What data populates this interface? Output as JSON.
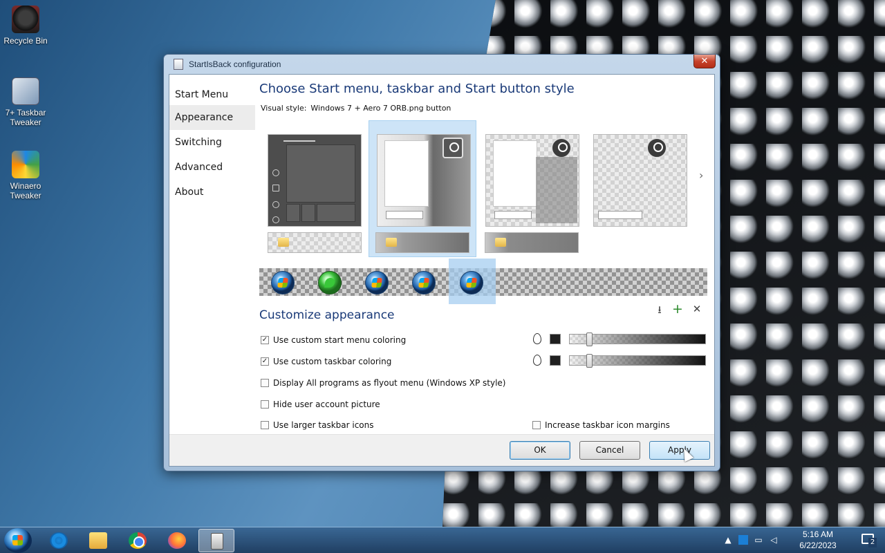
{
  "desktop": {
    "icons": [
      {
        "label": "Recycle Bin",
        "icon": "recycle-bin-icon"
      },
      {
        "label": "7+ Taskbar Tweaker",
        "icon": "taskbar-tweaker-icon"
      },
      {
        "label": "Winaero Tweaker",
        "icon": "winaero-icon"
      }
    ]
  },
  "window": {
    "title": "StartIsBack configuration",
    "close_label": "✕",
    "nav": [
      {
        "label": "Start Menu",
        "active": false
      },
      {
        "label": "Appearance",
        "active": true
      },
      {
        "label": "Switching",
        "active": false
      },
      {
        "label": "Advanced",
        "active": false
      },
      {
        "label": "About",
        "active": false
      }
    ],
    "heading": "Choose Start menu, taskbar and Start button style",
    "visual_style_label": "Visual style:",
    "visual_style_value": "Windows 7 + Aero 7 ORB.png button",
    "next_arrow": "›",
    "customize_heading": "Customize appearance",
    "actions": {
      "download": "⭳",
      "add": "+",
      "remove": "✕"
    },
    "options": {
      "custom_start_menu": {
        "label": "Use custom start menu coloring",
        "checked": true,
        "check_mark": "✓",
        "slider_level": 0.13
      },
      "custom_taskbar": {
        "label": "Use custom taskbar coloring",
        "checked": true,
        "check_mark": "✓",
        "slider_level": 0.13
      },
      "flyout_menu": {
        "label": "Display All programs as flyout menu (Windows XP style)",
        "checked": false
      },
      "hide_user_pic": {
        "label": "Hide user account picture",
        "checked": false
      },
      "larger_icons": {
        "label": "Use larger taskbar icons",
        "checked": false
      },
      "icon_margins": {
        "label": "Increase taskbar icon margins",
        "checked": false
      }
    },
    "buttons": {
      "ok": "OK",
      "cancel": "Cancel",
      "apply": "Apply"
    }
  },
  "taskbar": {
    "apps": [
      "internet-explorer-icon",
      "file-explorer-icon",
      "chrome-icon",
      "firefox-icon",
      "startisback-icon"
    ],
    "time": "5:16 AM",
    "date": "6/22/2023",
    "notification_count": "2"
  },
  "colors": {
    "heading": "#1a3a78",
    "selection": "#cde4f7",
    "accent_border": "#3c7fb1"
  }
}
